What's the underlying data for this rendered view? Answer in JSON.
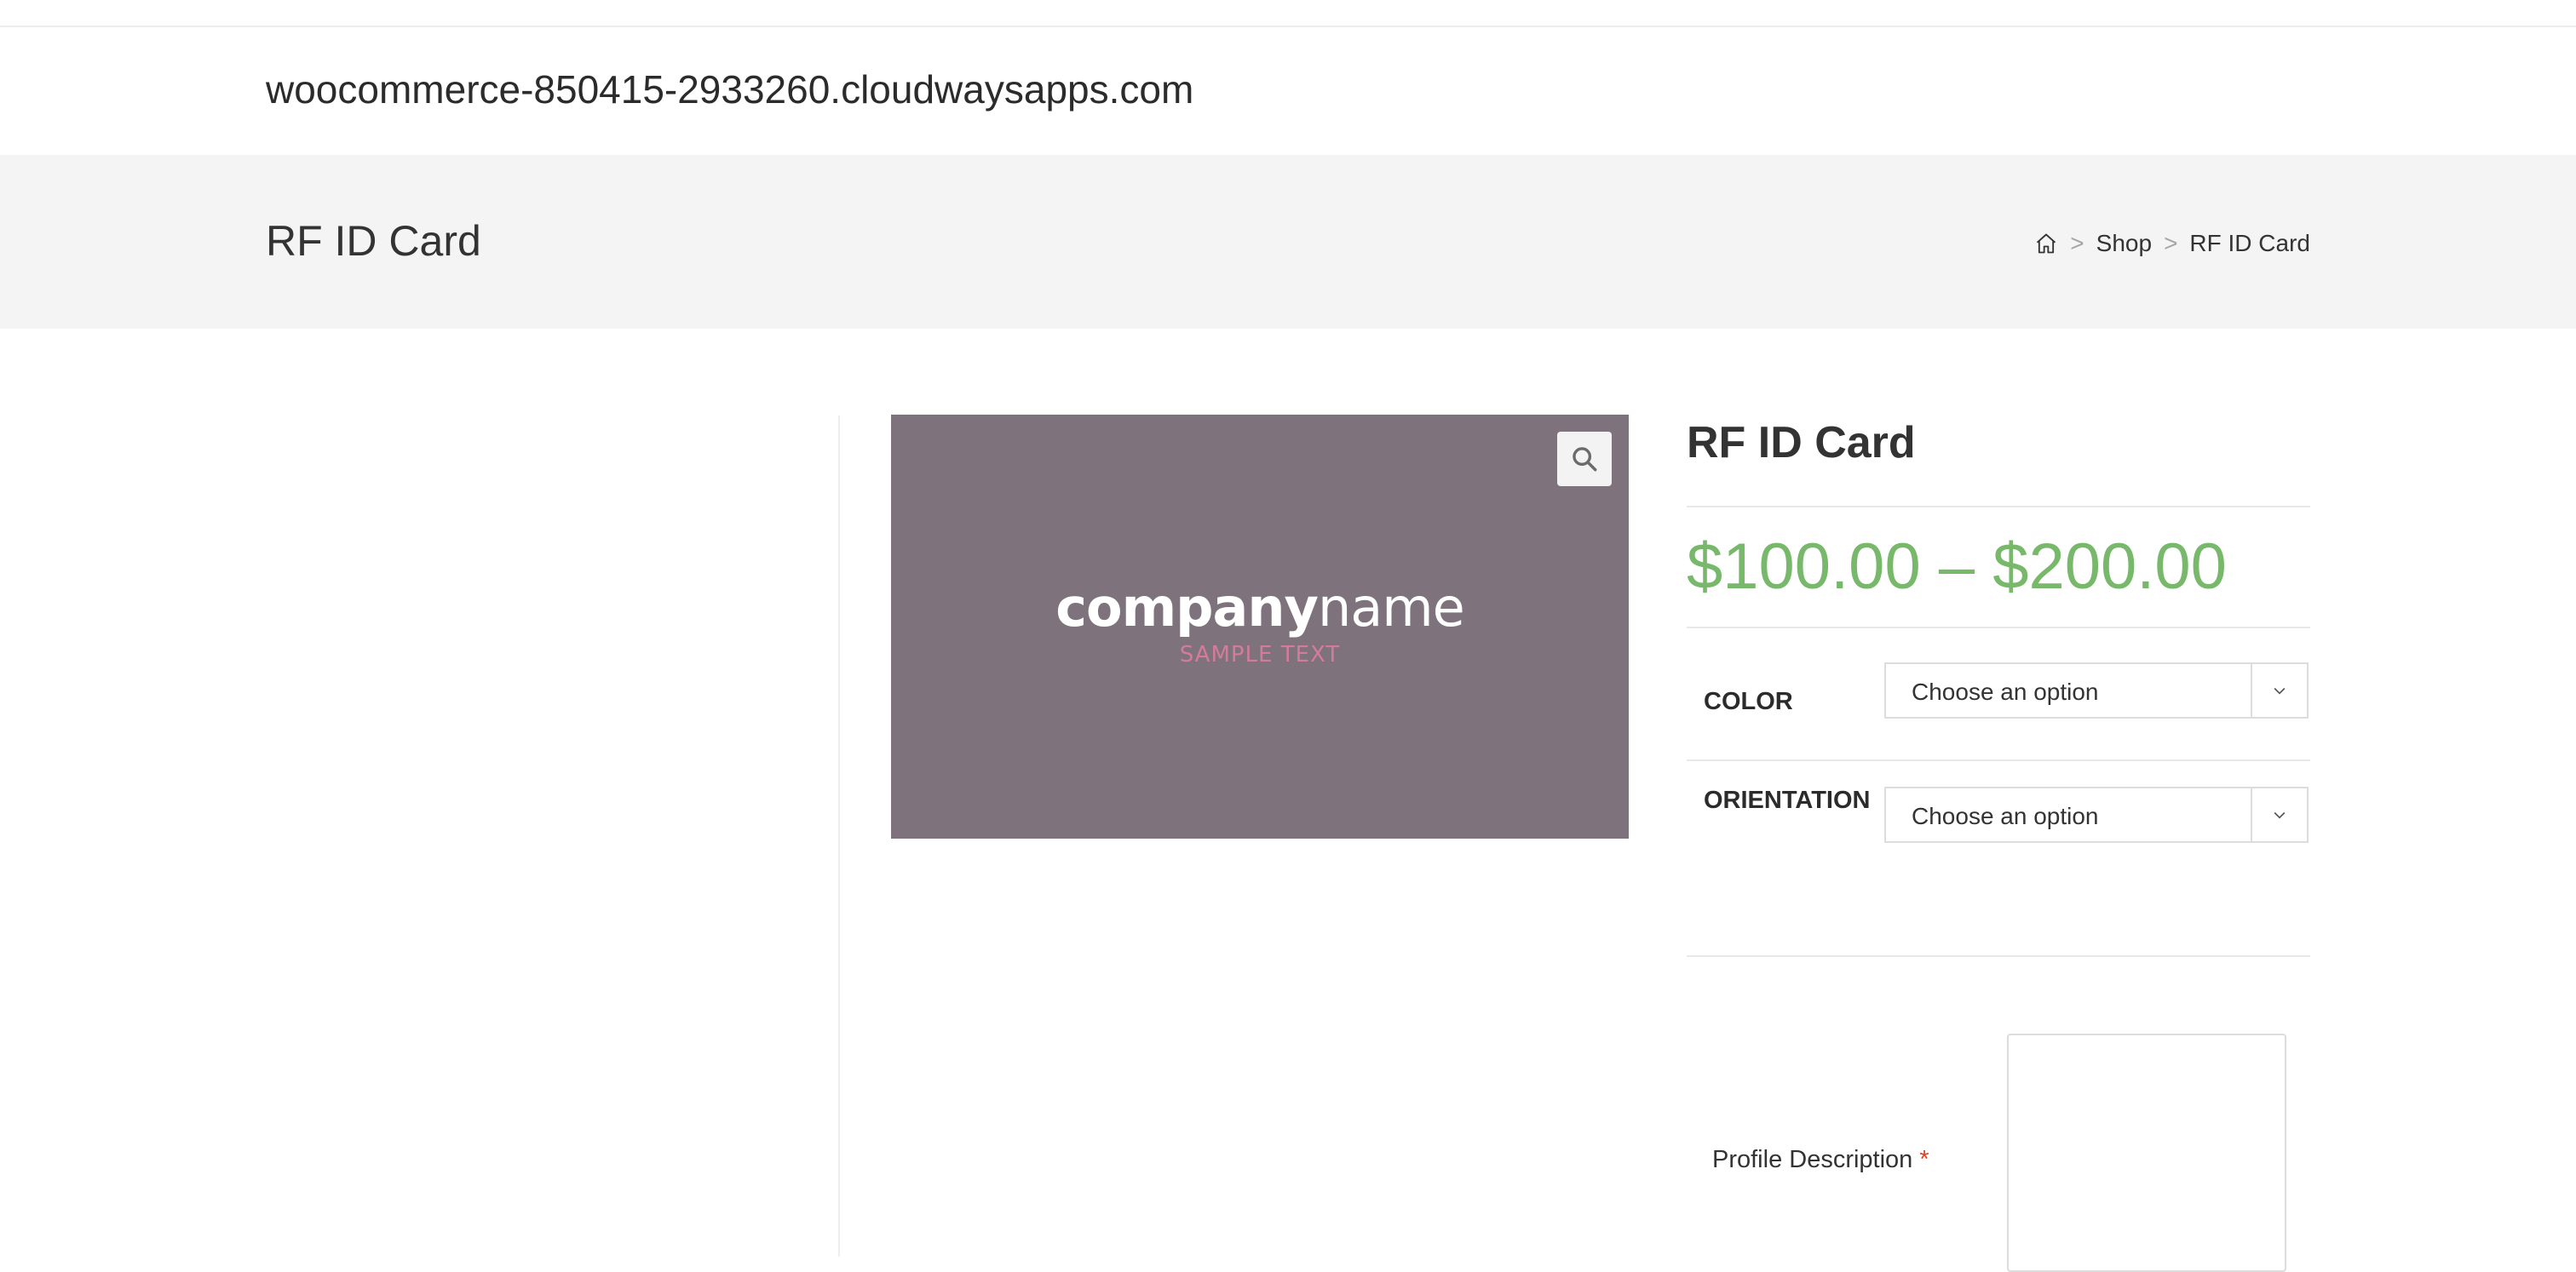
{
  "site": {
    "title": "woocommerce-850415-2933260.cloudwaysapps.com"
  },
  "page_header": {
    "title": "RF ID Card",
    "breadcrumb": {
      "home_icon": "home-icon",
      "separator": ">",
      "shop": "Shop",
      "current": "RF ID Card"
    }
  },
  "product": {
    "image": {
      "logo_bold": "company",
      "logo_light": "name",
      "logo_sub": "SAMPLE TEXT",
      "zoom_icon": "search-icon",
      "background_color": "#7e737d"
    },
    "title": "RF ID Card",
    "price": "$100.00 – $200.00",
    "price_color": "#77b86b",
    "attributes": [
      {
        "label": "COLOR",
        "value": "Choose an option"
      },
      {
        "label": "ORIENTATION",
        "value": "Choose an option"
      }
    ],
    "profile_description": {
      "label": "Profile Description",
      "required_mark": "*"
    }
  }
}
